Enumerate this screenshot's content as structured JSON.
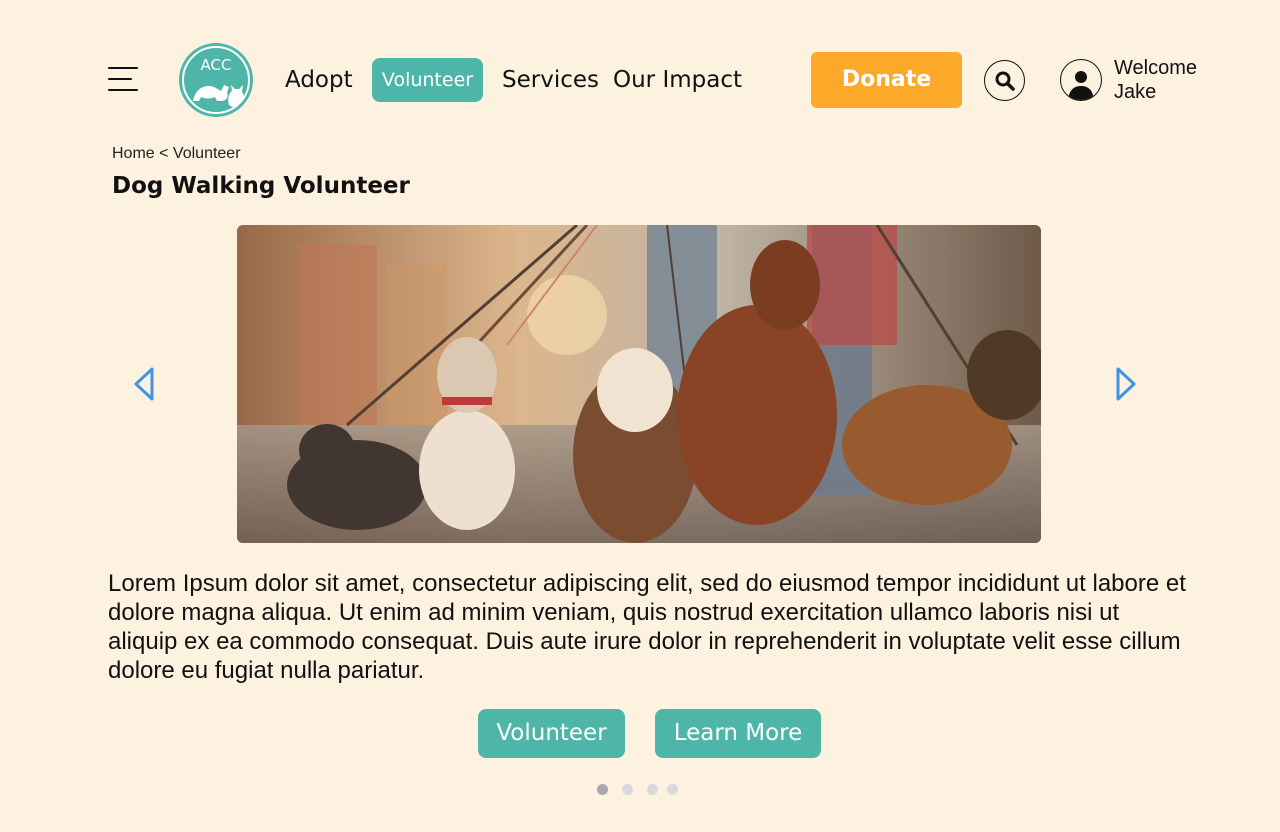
{
  "header": {
    "logo_text": "ACC",
    "nav": [
      {
        "label": "Adopt"
      },
      {
        "label": "Volunteer",
        "active": true
      },
      {
        "label": "Services"
      },
      {
        "label": "Our Impact"
      }
    ],
    "donate_label": "Donate",
    "user_greeting": "Welcome",
    "user_name": "Jake"
  },
  "breadcrumb": {
    "home": "Home",
    "separator": " < ",
    "current": "Volunteer"
  },
  "page": {
    "title": "Dog Walking Volunteer",
    "description": "Lorem Ipsum dolor sit amet, consectetur adipiscing elit, sed do eiusmod tempor incididunt ut labore et dolore magna aliqua. Ut enim ad minim veniam, quis nostrud exercitation ullamco laboris nisi ut aliquip ex ea commodo consequat. Duis aute irure dolor in reprehenderit in voluptate velit esse cillum dolore eu fugiat nulla pariatur.",
    "primary_button": "Volunteer",
    "secondary_button": "Learn More"
  },
  "carousel": {
    "slide_count": 4,
    "active_index": 0
  },
  "colors": {
    "background": "#fdf1df",
    "teal": "#4db6a8",
    "donate": "#fca92a",
    "arrow": "#3f94e6"
  },
  "icons": [
    "menu-icon",
    "search-icon",
    "user-icon",
    "chevron-left-icon",
    "chevron-right-icon"
  ]
}
